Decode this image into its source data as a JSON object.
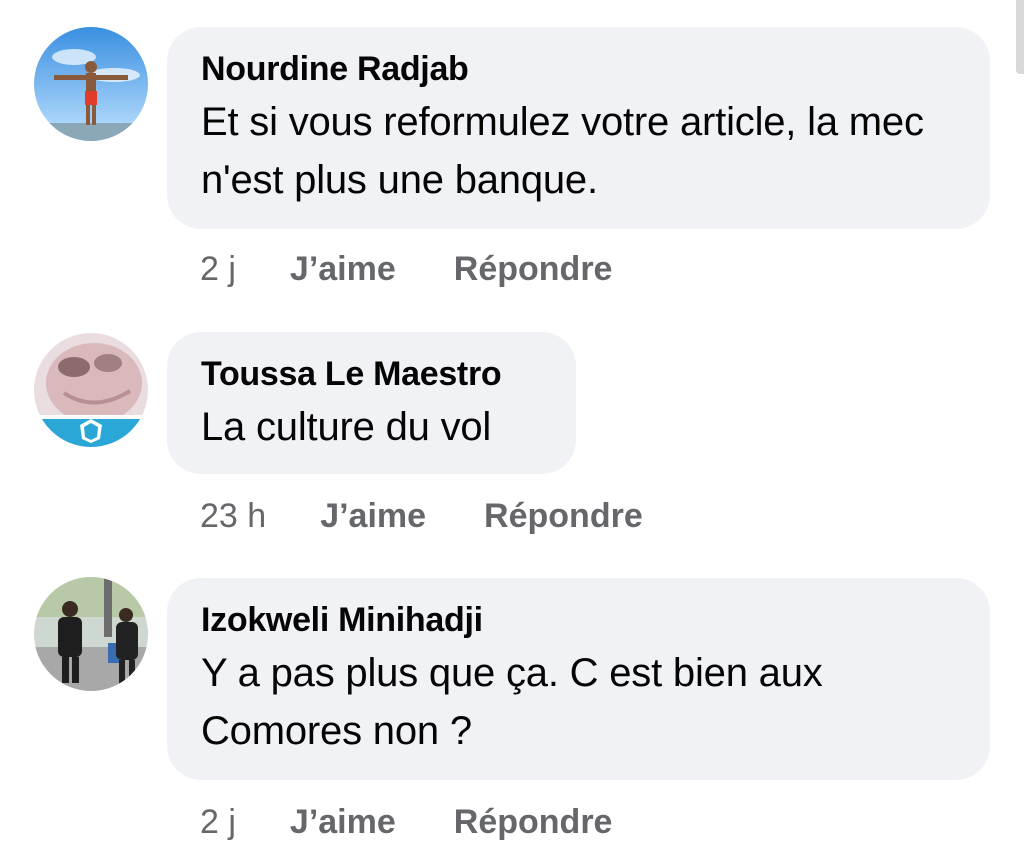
{
  "comments": [
    {
      "author": "Nourdine Radjab",
      "text": "Et si vous reformulez votre article, la mec n'est plus une banque.",
      "time": "2 j",
      "like_label": "J’aime",
      "reply_label": "Répondre",
      "avatar_icon": "person-arms-outstretched-sky"
    },
    {
      "author": "Toussa Le Maestro",
      "text": "La culture du vol",
      "time": "23 h",
      "like_label": "J’aime",
      "reply_label": "Répondre",
      "avatar_icon": "face-closeup-club-banner"
    },
    {
      "author": "Izokweli Minihadji",
      "text": "Y a pas plus que ça. C est bien aux Comores non ?",
      "time": "2 j",
      "like_label": "J’aime",
      "reply_label": "Répondre",
      "avatar_icon": "two-people-street"
    }
  ],
  "colors": {
    "bubble": "#f0f2f5",
    "meta_text": "#65676b",
    "text": "#050505"
  }
}
